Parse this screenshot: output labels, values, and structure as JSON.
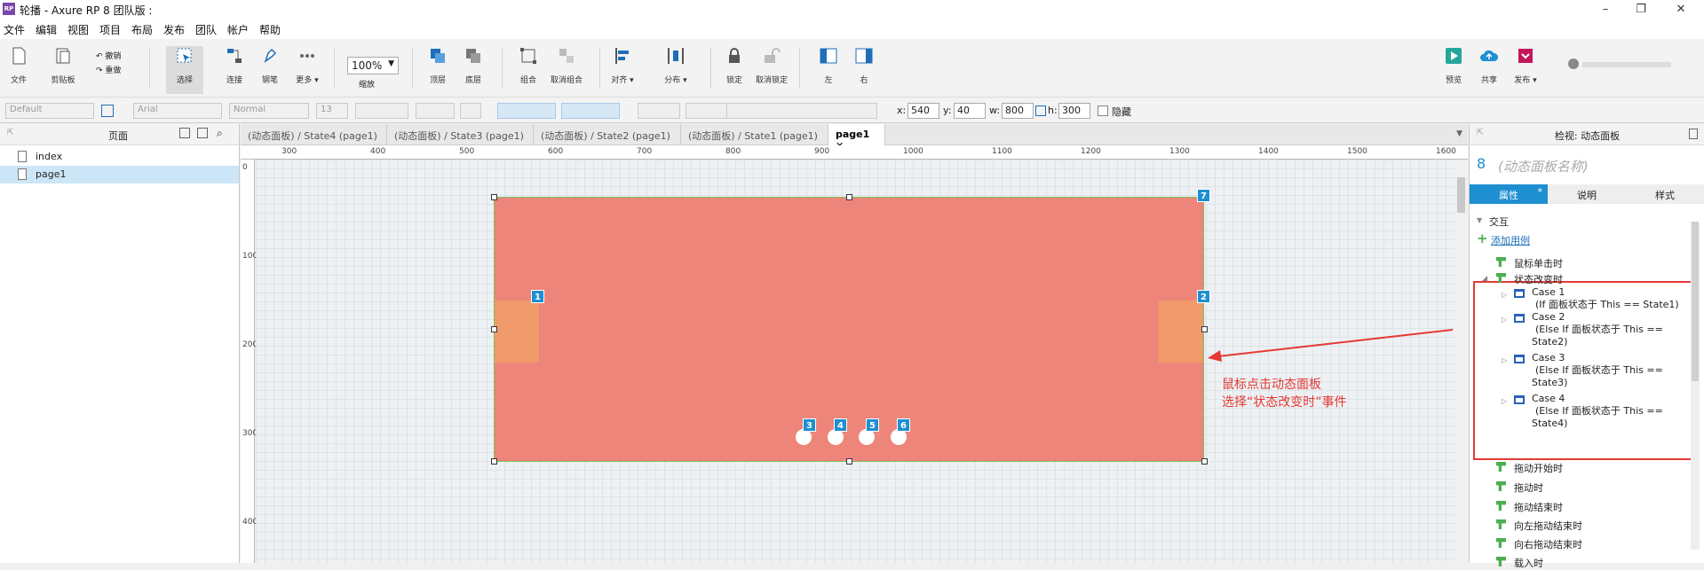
{
  "window": {
    "title": "轮播 - Axure RP 8 团队版 : ",
    "logo": "RP",
    "controls": {
      "minimize": "–",
      "maximize": "❐",
      "close": "✕"
    }
  },
  "menu": [
    "文件",
    "编辑",
    "视图",
    "项目",
    "布局",
    "发布",
    "团队",
    "帐户",
    "帮助"
  ],
  "toolbar": {
    "file": "文件",
    "clipboard": "剪贴板",
    "undo": "撤销",
    "redo": "重做",
    "select": "选择",
    "connect": "连接",
    "pen": "钢笔",
    "more": "更多 ▾",
    "zoom_value": "100%",
    "zoom_label": "缩放",
    "top": "顶层",
    "bottom": "底层",
    "group": "组合",
    "ungroup": "取消组合",
    "align": "对齐 ▾",
    "distribute": "分布 ▾",
    "lock": "锁定",
    "unlock": "取消锁定",
    "left": "左",
    "right": "右",
    "preview": "预览",
    "share": "共享",
    "publish": "发布 ▾"
  },
  "format": {
    "style": "Default",
    "font": "Arial",
    "weight": "Normal",
    "size": "13",
    "x_label": "x:",
    "x": "540",
    "y_label": "y:",
    "y": "40",
    "w_label": "w:",
    "w": "800",
    "h_label": "h:",
    "h": "300",
    "hidden": "隐藏"
  },
  "pages_panel": {
    "title": "页面",
    "pages": [
      "index",
      "page1"
    ],
    "selected": "page1"
  },
  "tabs": [
    {
      "label": "(动态面板) / State4 (page1)",
      "close": "✕"
    },
    {
      "label": "(动态面板) / State3 (page1)",
      "close": "✕"
    },
    {
      "label": "(动态面板) / State2 (page1)",
      "close": "✕"
    },
    {
      "label": "(动态面板) / State1 (page1)",
      "close": "✕"
    },
    {
      "label": "page1",
      "close": "✕",
      "active": true
    }
  ],
  "ruler": {
    "h": [
      "300",
      "400",
      "500",
      "600",
      "700",
      "800",
      "900",
      "1000",
      "1100",
      "1200",
      "1300",
      "1400",
      "1500",
      "1600"
    ],
    "v": [
      "0",
      "100",
      "200",
      "300",
      "400"
    ]
  },
  "canvas": {
    "badges": [
      "7",
      "1",
      "2",
      "3",
      "4",
      "5",
      "6"
    ],
    "annotation_line1": "鼠标点击动态面板",
    "annotation_line2": "选择“状态改变时”事件",
    "colors": {
      "panel": "#ee857a",
      "arrow_button": "#f19a6c",
      "badge": "#1e8fd0",
      "annotation": "#e53935"
    }
  },
  "inspector": {
    "title": "检视: 动态面板",
    "number": "8",
    "name_placeholder": "(动态面板名称)",
    "tabs": [
      "属性",
      "说明",
      "样式"
    ],
    "tab_marker": "*",
    "section": "交互",
    "add_case": "添加用例",
    "events_before": [
      "鼠标单击时"
    ],
    "expanded_event": "状态改变时",
    "cases": [
      {
        "name": "Case 1",
        "cond1": "(If 面板状态于 This == State1)",
        "cond2": ""
      },
      {
        "name": "Case 2",
        "cond1": "(Else If 面板状态于 This ==",
        "cond2": "State2)"
      },
      {
        "name": "Case 3",
        "cond1": "(Else If 面板状态于 This ==",
        "cond2": "State3)"
      },
      {
        "name": "Case 4",
        "cond1": "(Else If 面板状态于 This ==",
        "cond2": "State4)"
      }
    ],
    "events_after": [
      "拖动开始时",
      "拖动时",
      "拖动结束时",
      "向左拖动结束时",
      "向右拖动结束时",
      "载入时"
    ]
  }
}
